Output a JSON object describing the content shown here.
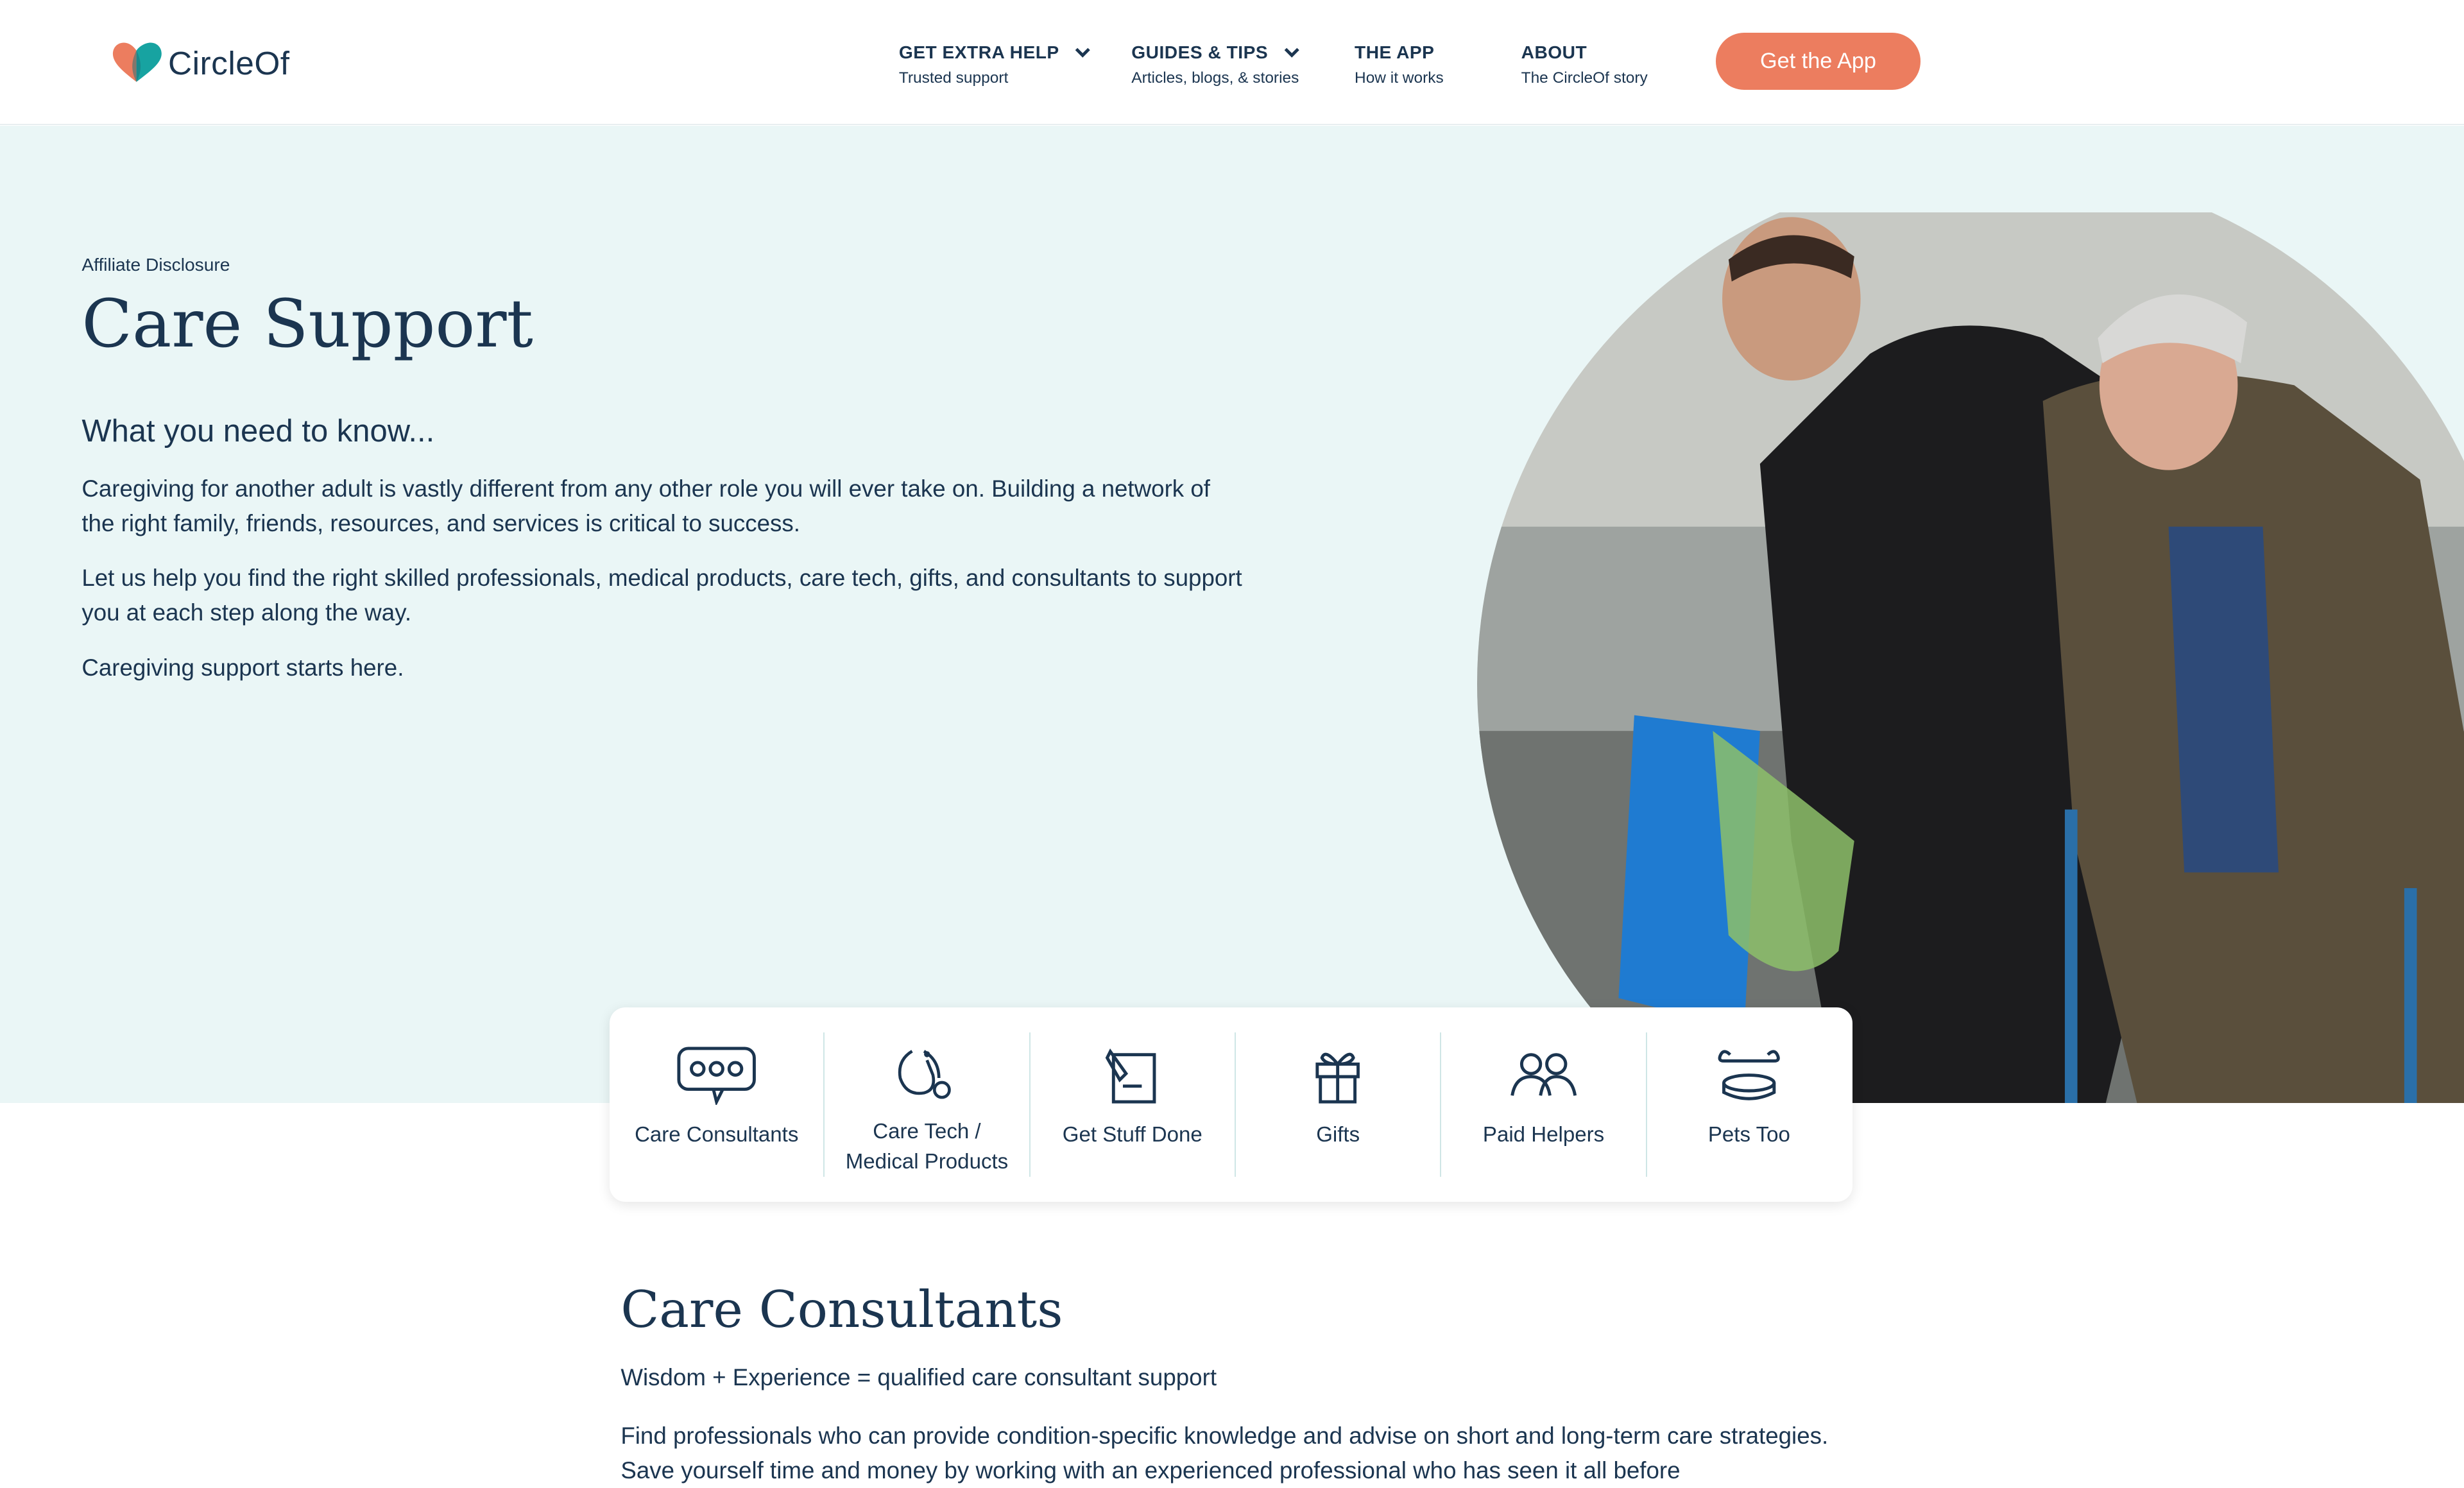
{
  "brand": {
    "name": "CircleOf",
    "colors": {
      "accent": "#ec7d5f",
      "teal": "#17a3a1",
      "navy": "#1b3550",
      "hero_bg": "#eaf6f6"
    }
  },
  "nav": [
    {
      "title": "GET EXTRA HELP",
      "sub": "Trusted support",
      "dropdown": true
    },
    {
      "title": "GUIDES & TIPS",
      "sub": "Articles, blogs, & stories",
      "dropdown": true
    },
    {
      "title": "THE APP",
      "sub": "How it works",
      "dropdown": false
    },
    {
      "title": "ABOUT",
      "sub": "The CircleOf story",
      "dropdown": false
    }
  ],
  "cta": "Get the App",
  "hero": {
    "eyebrow": "Affiliate Disclosure",
    "title": "Care Support",
    "subtitle": "What you need to know...",
    "paragraphs": [
      "Caregiving for another adult is vastly different from any other role you will ever take on. Building a network of the right family, friends, resources, and services is critical to success.",
      "Let us help you find the right skilled professionals, medical products, care tech, gifts, and consultants to support you at each step along the way.",
      "Caregiving support starts here."
    ]
  },
  "categories": [
    {
      "label": "Care Consultants",
      "icon": "chat-bubble-icon"
    },
    {
      "label": "Care Tech /\nMedical Products",
      "icon": "stethoscope-icon"
    },
    {
      "label": "Get Stuff Done",
      "icon": "checklist-icon"
    },
    {
      "label": "Gifts",
      "icon": "gift-icon"
    },
    {
      "label": "Paid Helpers",
      "icon": "people-icon"
    },
    {
      "label": "Pets Too",
      "icon": "bone-icon"
    }
  ],
  "section": {
    "title": "Care Consultants",
    "subtitle": "Wisdom + Experience = qualified care consultant support",
    "body": "Find professionals who can provide condition-specific knowledge and advise on short and long-term care strategies. Save yourself time and money by working with an experienced professional who has seen it all before"
  }
}
